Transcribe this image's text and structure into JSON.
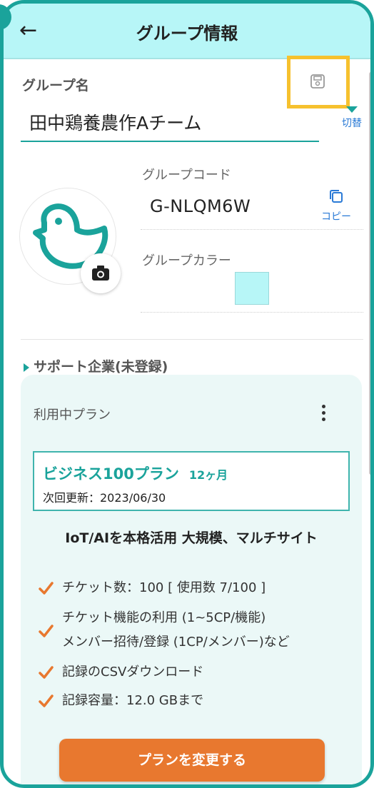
{
  "header": {
    "title": "グループ情報",
    "back_icon": "arrow-left-icon"
  },
  "group": {
    "name_label": "グループ名",
    "name_value": "田中鶏養農作Aチーム",
    "switch_label": "切替",
    "code_label": "グループコード",
    "code_value": "G-NLQM6W",
    "copy_label": "コピー",
    "color_label": "グループカラー",
    "color_value": "#b7f6f7"
  },
  "support": {
    "label": "サポート企業(未登録)"
  },
  "plan": {
    "section_title": "利用中プラン",
    "name": "ビジネス100プラン",
    "term": "12ヶ月",
    "renewal": "次回更新：2023/06/30",
    "description": "IoT/AIを本格活用 大規模、マルチサイト",
    "features": [
      "チケット数：100 [ 使用数 7/100 ]",
      "チケット機能の利用 (1~5CP/機能)",
      "メンバー招待/登録 (1CP/メンバー)など",
      "記録のCSVダウンロード",
      "記録容量：12.0 GBまで"
    ],
    "change_button": "プランを変更する"
  },
  "colors": {
    "accent": "#1aa39b",
    "header_bg": "#b7f6f7",
    "highlight": "#f6c12e",
    "button": "#e8782f",
    "link": "#2a7ad6"
  }
}
